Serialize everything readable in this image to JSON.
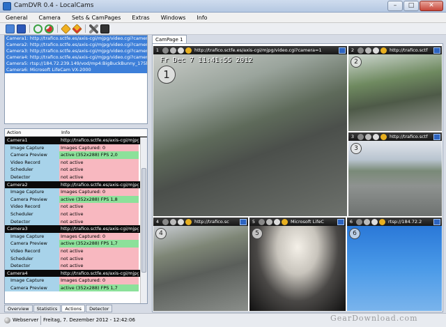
{
  "window": {
    "title": "CamDVR 0.4 - LocalCams",
    "min": "–",
    "max": "□",
    "close": "✕"
  },
  "menu": [
    "General",
    "Camera",
    "Sets & CamPages",
    "Extras",
    "Windows",
    "Info"
  ],
  "toolbar": [
    "monitor-icon",
    "save-icon",
    "refresh-icon",
    "refresh-stop-icon",
    "warning-icon",
    "warning-stop-icon",
    "tools-icon",
    "film-icon"
  ],
  "cameras": [
    "Camera1: http://trafico.sctfe.es/axis-cgi/mjpg/video.cgi?camera=1",
    "Camera2: http://trafico.sctfe.es/axis-cgi/mjpg/video.cgi?camera=2",
    "Camera3: http://trafico.sctfe.es/axis-cgi/mjpg/video.cgi?camera=3",
    "Camera4: http://trafico.sctfe.es/axis-cgi/mjpg/video.cgi?camera=4",
    "Camera5: rtsp://184.72.239.149/vod/mp4:BigBuckBunny_175k.mov",
    "Camera6: Microsoft LifeCam VX-2000"
  ],
  "actions": {
    "col_action": "Action",
    "col_info": "Info",
    "rows": [
      {
        "type": "cam",
        "action": "Camera1",
        "info": "http://trafico.sctfe.es/axis-cgi/mjpg/vi"
      },
      {
        "type": "red",
        "action": "Image Capture",
        "info": "Images Captured: 0"
      },
      {
        "type": "green",
        "action": "Camera Preview",
        "info": "active (352x288)  FPS 2,0"
      },
      {
        "type": "red",
        "action": "Video Record",
        "info": "not active"
      },
      {
        "type": "red",
        "action": "Scheduler",
        "info": "not active"
      },
      {
        "type": "red",
        "action": "Detector",
        "info": "not active"
      },
      {
        "type": "cam",
        "action": "Camera2",
        "info": "http://trafico.sctfe.es/axis-cgi/mjpg/vi"
      },
      {
        "type": "red",
        "action": "Image Capture",
        "info": "Images Captured: 0"
      },
      {
        "type": "green",
        "action": "Camera Preview",
        "info": "active (352x288)  FPS 1,8"
      },
      {
        "type": "red",
        "action": "Video Record",
        "info": "not active"
      },
      {
        "type": "red",
        "action": "Scheduler",
        "info": "not active"
      },
      {
        "type": "red",
        "action": "Detector",
        "info": "not active"
      },
      {
        "type": "cam",
        "action": "Camera3",
        "info": "http://trafico.sctfe.es/axis-cgi/mjpg/vi"
      },
      {
        "type": "red",
        "action": "Image Capture",
        "info": "Images Captured: 0"
      },
      {
        "type": "green",
        "action": "Camera Preview",
        "info": "active (352x288)  FPS 1,7"
      },
      {
        "type": "red",
        "action": "Video Record",
        "info": "not active"
      },
      {
        "type": "red",
        "action": "Scheduler",
        "info": "not active"
      },
      {
        "type": "red",
        "action": "Detector",
        "info": "not active"
      },
      {
        "type": "cam",
        "action": "Camera4",
        "info": "http://trafico.sctfe.es/axis-cgi/mjpg/vi"
      },
      {
        "type": "red",
        "action": "Image Capture",
        "info": "Images Captured: 0"
      },
      {
        "type": "green",
        "action": "Camera Preview",
        "info": "active (352x288)  FPS 1,7"
      }
    ]
  },
  "bottom_tabs": [
    "Overview",
    "Statistics",
    "Actions",
    "Detector"
  ],
  "active_bottom_tab": "Actions",
  "campage_tab": "CamPage 1",
  "views": [
    {
      "num": "1",
      "url": "http://trafico.sctfe.es/axis-cgi/mjpg/video.cgi?camera=1",
      "overlay": "Fr Dec  7 11:41:55 2012",
      "badge": "1"
    },
    {
      "num": "2",
      "url": "http://trafico.sctf",
      "badge": "2"
    },
    {
      "num": "3",
      "url": "http://trafico.sctf",
      "badge": "3"
    },
    {
      "num": "4",
      "url": "http://trafico.sc",
      "badge": "4"
    },
    {
      "num": "5",
      "url": "Microsoft LifeC",
      "badge": "5"
    },
    {
      "num": "6",
      "url": "rtsp://184.72.2",
      "badge": "6"
    }
  ],
  "status": {
    "webserver": "Webserver",
    "datetime": "Freitag, 7. Dezember 2012 - 12:42:06"
  },
  "watermark": "GearDownload.com"
}
